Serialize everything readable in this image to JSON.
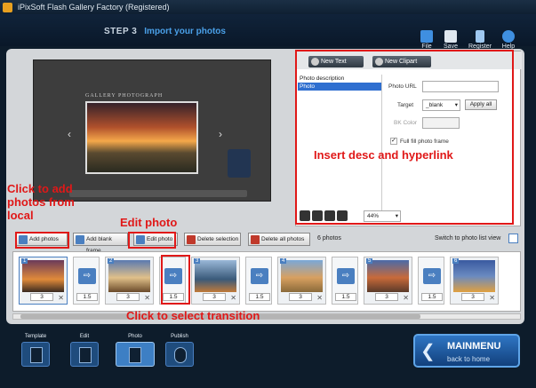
{
  "window": {
    "title": "iPixSoft Flash Gallery Factory (Registered)"
  },
  "header": {
    "step": "STEP 3",
    "step_title": "Import your photos",
    "tools": [
      {
        "label": "File"
      },
      {
        "label": "Save"
      },
      {
        "label": "Register"
      },
      {
        "label": "Help"
      }
    ]
  },
  "preview": {
    "gallery_title": "GALLERY PHOTOGRAPH"
  },
  "panel": {
    "new_text_label": "New Text",
    "new_clipart_label": "New Clipart",
    "list": [
      "Photo description",
      "Photo"
    ],
    "photo_url_label": "Photo URL",
    "photo_url_value": "",
    "target_label": "Target",
    "target_value": "_blank",
    "apply_all_label": "Apply all",
    "bk_color_label": "BK Color",
    "full_fill_label": "Full fill photo frame",
    "full_fill_checked": true,
    "zoom_value": "44%"
  },
  "actions": {
    "add_photos": "Add photos",
    "add_blank_frame": "Add blank frame",
    "edit_photo": "Edit photo",
    "delete_selection": "Delete selection",
    "delete_all_photos": "Delete all photos",
    "count": "6 photos",
    "switch_view": "Switch to photo list view"
  },
  "strip": {
    "photos": [
      {
        "num": "1",
        "dur": "3"
      },
      {
        "num": "2",
        "dur": "3"
      },
      {
        "num": "3",
        "dur": "3"
      },
      {
        "num": "4",
        "dur": "3"
      },
      {
        "num": "5",
        "dur": "3"
      },
      {
        "num": "6",
        "dur": "3"
      }
    ],
    "transitions": [
      "1.5",
      "1.5",
      "1.5",
      "1.5",
      "1.5"
    ]
  },
  "annotations": {
    "insert": "Insert desc and hyperlink",
    "add": "Click to add photos from local",
    "edit": "Edit photo",
    "transition": "Click to select transition"
  },
  "nav": {
    "template": "Template",
    "edit": "Edit",
    "photo": "Photo",
    "publish": "Publish"
  },
  "mainmenu": {
    "title": "MAINMENU",
    "subtitle": "back to home"
  },
  "colors": {
    "accent": "#4aa0e8",
    "annotation": "#e01818"
  }
}
